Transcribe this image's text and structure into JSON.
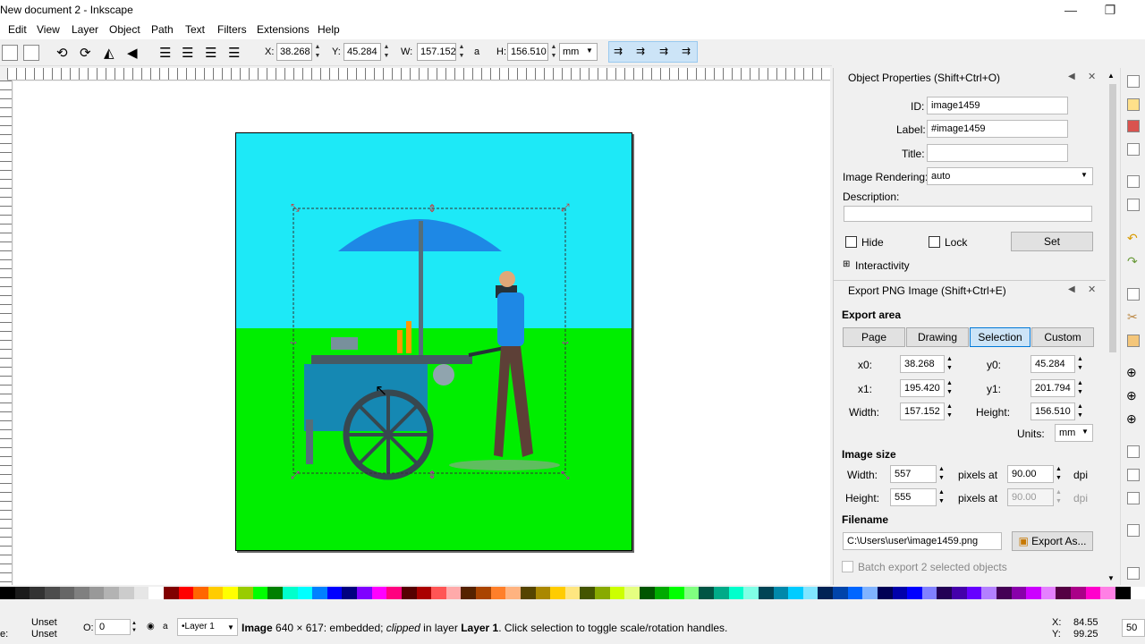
{
  "window": {
    "title": "New document 2 - Inkscape",
    "minimize": "—",
    "maximize": "❐"
  },
  "menu": [
    "Edit",
    "View",
    "Layer",
    "Object",
    "Path",
    "Text",
    "Filters",
    "Extensions",
    "Help"
  ],
  "toolbar": {
    "x_label": "X:",
    "x": "38.268",
    "y_label": "Y:",
    "y": "45.284",
    "w_label": "W:",
    "w": "157.152",
    "lock": "a",
    "h_label": "H:",
    "h": "156.510",
    "unit": "mm"
  },
  "properties": {
    "header": "Object Properties (Shift+Ctrl+O)",
    "id_label": "ID:",
    "id": "image1459",
    "label_label": "Label:",
    "label": "#image1459",
    "title_label": "Title:",
    "title": "",
    "rendering_label": "Image Rendering:",
    "rendering": "auto",
    "description_label": "Description:",
    "hide": "Hide",
    "lock": "Lock",
    "set": "Set",
    "interactivity": "Interactivity"
  },
  "export": {
    "header": "Export PNG Image (Shift+Ctrl+E)",
    "area_title": "Export area",
    "tabs": [
      "Page",
      "Drawing",
      "Selection",
      "Custom"
    ],
    "x0_label": "x0:",
    "x0": "38.268",
    "y0_label": "y0:",
    "y0": "45.284",
    "x1_label": "x1:",
    "x1": "195.420",
    "y1_label": "y1:",
    "y1": "201.794",
    "width_label": "Width:",
    "width": "157.152",
    "height_label": "Height:",
    "height": "156.510",
    "units_label": "Units:",
    "units": "mm",
    "image_size": "Image size",
    "img_width_label": "Width:",
    "img_width": "557",
    "img_height_label": "Height:",
    "img_height": "555",
    "pixels_at": "pixels at",
    "dpi_value": "90.00",
    "dpi_value2": "90.00",
    "dpi": "dpi",
    "filename_title": "Filename",
    "filename": "C:\\Users\\user\\image1459.png",
    "export_as": "Export As...",
    "batch": "Batch export 2 selected objects"
  },
  "status": {
    "fill": "Unset",
    "stroke": "Unset",
    "opacity_label": "O:",
    "opacity": "0",
    "layer": "•Layer 1",
    "msg_bold": "Image",
    "msg1": " 640 × 617: embedded; ",
    "msg_italic": "clipped",
    "msg2": " in layer ",
    "msg_layer": "Layer 1",
    "msg3": ". Click selection to toggle scale/rotation handles.",
    "x_label": "X:",
    "x": "84.55",
    "y_label": "Y:",
    "y": "99.25",
    "zoom": "50",
    "e": "e:"
  },
  "palette": [
    "#000000",
    "#1a1a1a",
    "#333333",
    "#4d4d4d",
    "#666666",
    "#808080",
    "#999999",
    "#b3b3b3",
    "#cccccc",
    "#e6e6e6",
    "#ffffff",
    "#800000",
    "#ff0000",
    "#ff6600",
    "#ffcc00",
    "#ffff00",
    "#99cc00",
    "#00ff00",
    "#008000",
    "#00ffcc",
    "#00ffff",
    "#0080ff",
    "#0000ff",
    "#000080",
    "#8000ff",
    "#ff00ff",
    "#ff0080",
    "#550000",
    "#aa0000",
    "#ff5555",
    "#ffaaaa",
    "#552200",
    "#aa4400",
    "#ff7f2a",
    "#ffb380",
    "#554400",
    "#aa8800",
    "#ffcc00",
    "#ffe680",
    "#445500",
    "#88aa00",
    "#ccff00",
    "#e5ff80",
    "#005500",
    "#00aa00",
    "#00ff00",
    "#80ff80",
    "#005544",
    "#00aa88",
    "#00ffcc",
    "#80ffe6",
    "#004455",
    "#0088aa",
    "#00ccff",
    "#80e5ff",
    "#002255",
    "#0044aa",
    "#0066ff",
    "#80b3ff",
    "#000055",
    "#0000aa",
    "#0000ff",
    "#8080ff",
    "#220055",
    "#4400aa",
    "#6600ff",
    "#b380ff",
    "#440055",
    "#8800aa",
    "#cc00ff",
    "#e580ff",
    "#550044",
    "#aa0088",
    "#ff00cc",
    "#ff80e5",
    "#000000",
    "#ffffff"
  ]
}
